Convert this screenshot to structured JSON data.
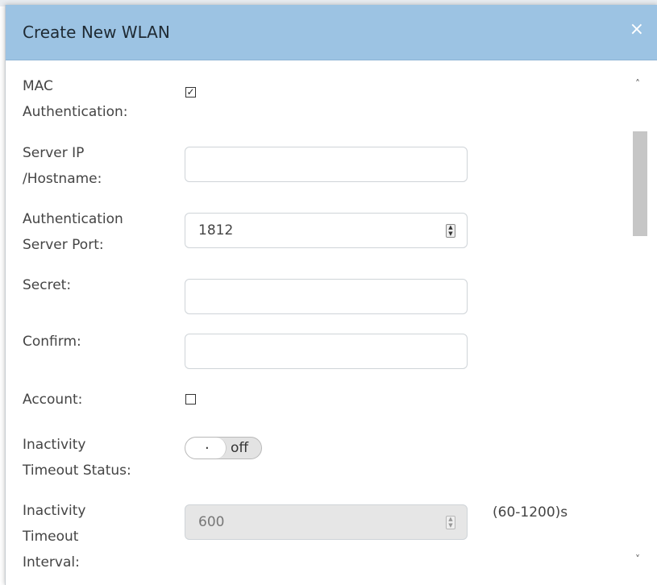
{
  "backdrop": {
    "left_text": "……",
    "right_text": "…"
  },
  "dialog": {
    "title": "Create New WLAN",
    "close_glyph": "×",
    "header_color": "#9cc3e3"
  },
  "form": {
    "mac_auth": {
      "label_line1": "MAC",
      "label_line2": "Authentication:",
      "checked": true,
      "check_glyph": "✓"
    },
    "server_ip": {
      "label_line1": "Server IP",
      "label_line2": "/Hostname:",
      "value": ""
    },
    "auth_port": {
      "label_line1": "Authentication",
      "label_line2": "Server Port:",
      "value": "1812"
    },
    "secret": {
      "label": "Secret:",
      "value": ""
    },
    "confirm": {
      "label": "Confirm:",
      "value": ""
    },
    "account": {
      "label": "Account:",
      "checked": false
    },
    "inactivity_status": {
      "label_line1": "Inactivity",
      "label_line2": "Timeout Status:",
      "toggle_knob_text": ".",
      "toggle_text": "off"
    },
    "inactivity_interval": {
      "label_line1": "Inactivity",
      "label_line2": "Timeout",
      "label_line3": "Interval:",
      "value": "600",
      "range": "(60-1200)s",
      "disabled": true
    }
  },
  "scrollbar": {
    "up_glyph": "˄",
    "down_glyph": "˅"
  },
  "icons": {
    "close": "close-icon",
    "checkbox_checked": "check-icon",
    "spinner": "spinner-arrows-icon",
    "scroll_up": "chevron-up-icon",
    "scroll_down": "chevron-down-icon"
  }
}
